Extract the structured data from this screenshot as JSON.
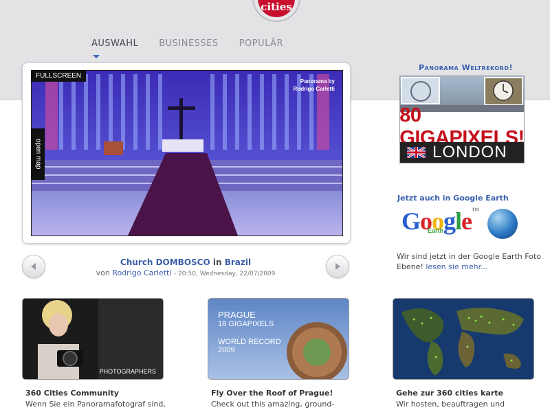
{
  "logo": {
    "text": "cities"
  },
  "nav": {
    "tabs": [
      {
        "label": "AUSWAHL",
        "active": true
      },
      {
        "label": "BUSINESSES",
        "active": false
      },
      {
        "label": "POPULÄR",
        "active": false
      }
    ]
  },
  "viewer": {
    "fullscreen_label": "FULLSCREEN",
    "open_map_label": "open map",
    "credit_line1": "Panorama by",
    "credit_line2": "Rodrigo Carletti"
  },
  "caption": {
    "place": "Church DOMBOSCO",
    "in_word": "in",
    "country": "Brazil",
    "by_word": "von",
    "author": "Rodrigo Carletti",
    "timestamp": "- 20:50, Wednesday, 22/07/2009"
  },
  "sidebar": {
    "record_title": "Panorama Weltrekord!",
    "banner_gigapixels": "80 GIGAPIXELS!",
    "banner_city": "LONDON",
    "earth_title": "Jetzt auch in Google Earth",
    "google_letters": [
      "G",
      "o",
      "o",
      "g",
      "l",
      "e"
    ],
    "google_colors": [
      "#2a5fd0",
      "#d8232a",
      "#f2b50f",
      "#2a5fd0",
      "#2f9e44",
      "#d8232a"
    ],
    "google_tm": "™",
    "earth_sub": "Earth",
    "earth_text": "Wir sind jetzt in der Google Earth Foto Ebene!",
    "earth_link": "lesen sie mehr..."
  },
  "cards": [
    {
      "image_label": "PHOTOGRAPHERS",
      "title": "360 Cities Community",
      "text": "Wenn Sie ein Panoramafotograf sind,"
    },
    {
      "image_line1": "PRAGUE",
      "image_line2": "18 GIGAPIXELS",
      "image_line3": "WORLD RECORD",
      "image_line4": "2009",
      "title": "Fly Over the Roof of Prague!",
      "text": "Check out this amazing, ground-"
    },
    {
      "title": "Gehe zur 360 cities karte",
      "text": "Wir hosten, beauftragen und"
    }
  ],
  "colors": {
    "link": "#3b5ea8",
    "side_title": "#3a63b0",
    "header_bg": "#e3e3e6"
  }
}
